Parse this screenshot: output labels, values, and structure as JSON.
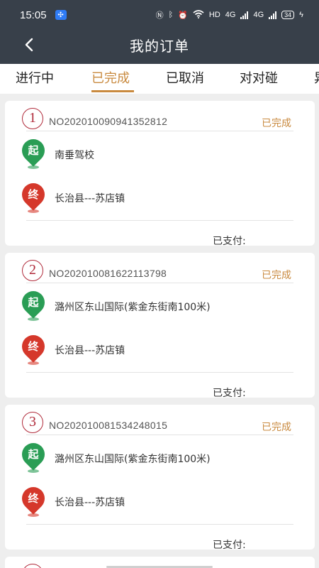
{
  "status_bar": {
    "time": "15:05",
    "indicators": "HD",
    "network_1": "4G",
    "network_2": "4G",
    "battery": "34",
    "icons": [
      "nfc-icon",
      "bluetooth-icon",
      "alarm-icon",
      "wifi-icon",
      "charging-icon"
    ]
  },
  "header": {
    "title": "我的订单",
    "back_icon": "chevron-left-icon"
  },
  "tabs": [
    {
      "label": "进行中",
      "active": false
    },
    {
      "label": "已完成",
      "active": true
    },
    {
      "label": "已取消",
      "active": false
    },
    {
      "label": "对对碰",
      "active": false
    },
    {
      "label": "异",
      "active": false
    }
  ],
  "colors": {
    "header_bg": "#38404a",
    "accent": "#c98a3f",
    "start_pin": "#2a9d55",
    "end_pin": "#d5382b",
    "index_circle": "#b02a3a"
  },
  "orders": [
    {
      "index": "1",
      "order_no": "NO202010090941352812",
      "status": "已完成",
      "start_tag": "起",
      "start_address": "南垂驾校",
      "end_tag": "终",
      "end_address": "长治县---苏店镇",
      "paid_label": "已支付:"
    },
    {
      "index": "2",
      "order_no": "NO202010081622113798",
      "status": "已完成",
      "start_tag": "起",
      "start_address": "潞州区东山国际(紫金东街南100米)",
      "end_tag": "终",
      "end_address": "长治县---苏店镇",
      "paid_label": "已支付:"
    },
    {
      "index": "3",
      "order_no": "NO202010081534248015",
      "status": "已完成",
      "start_tag": "起",
      "start_address": "潞州区东山国际(紫金东街南100米)",
      "end_tag": "终",
      "end_address": "长治县---苏店镇",
      "paid_label": "已支付:"
    }
  ]
}
